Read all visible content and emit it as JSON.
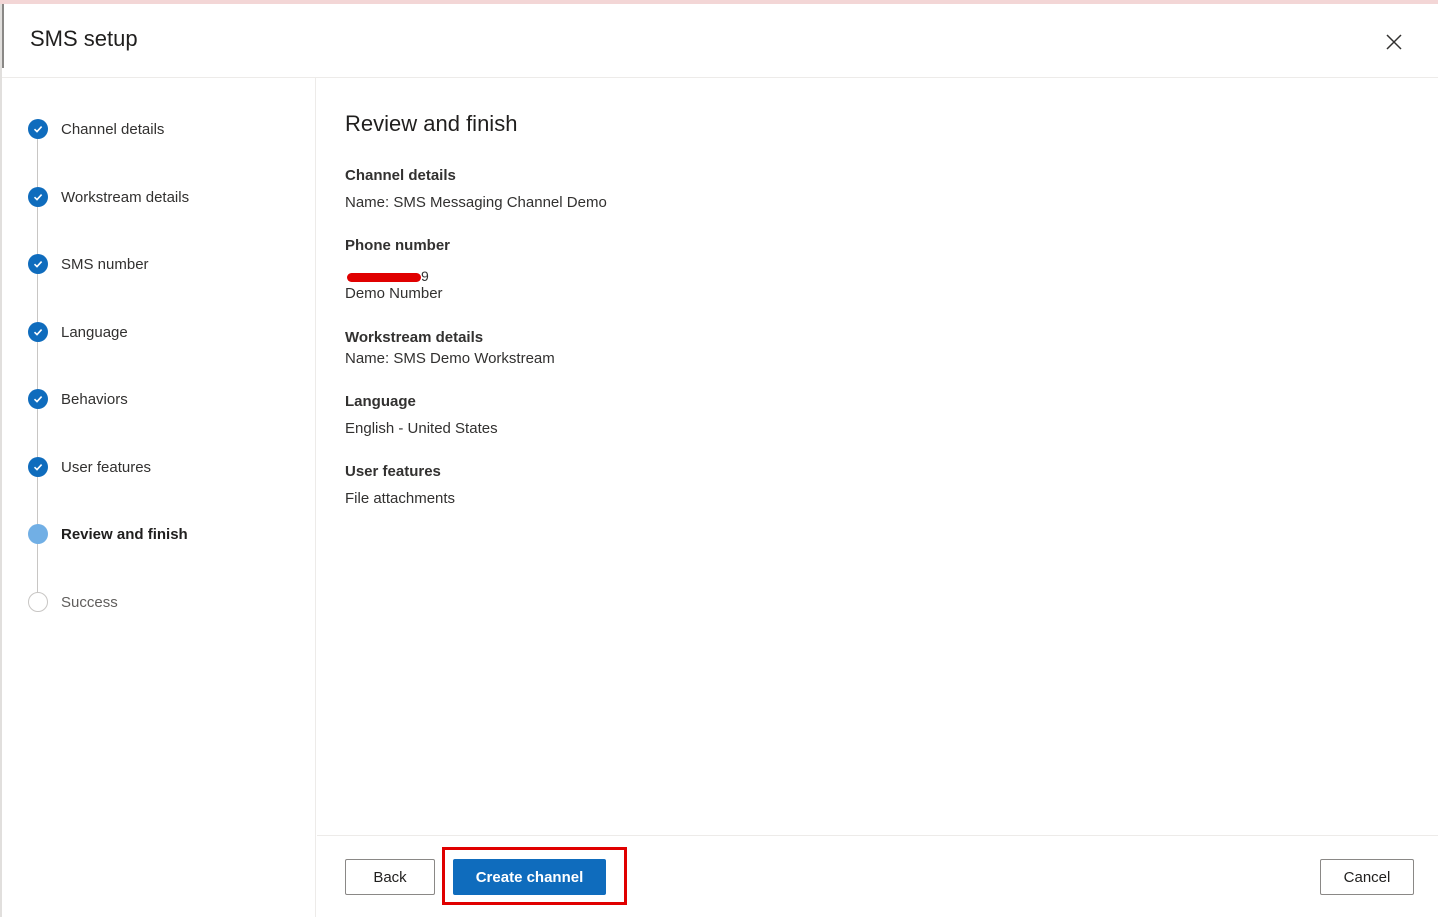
{
  "dialog": {
    "title": "SMS setup",
    "close_icon": "close-icon"
  },
  "steps": [
    {
      "label": "Channel details",
      "status": "completed"
    },
    {
      "label": "Workstream details",
      "status": "completed"
    },
    {
      "label": "SMS number",
      "status": "completed"
    },
    {
      "label": "Language",
      "status": "completed"
    },
    {
      "label": "Behaviors",
      "status": "completed"
    },
    {
      "label": "User features",
      "status": "completed"
    },
    {
      "label": "Review and finish",
      "status": "current"
    },
    {
      "label": "Success",
      "status": "pending"
    }
  ],
  "review": {
    "title": "Review and finish",
    "channel_details": {
      "heading": "Channel details",
      "value": "Name: SMS Messaging Channel Demo"
    },
    "phone_number": {
      "heading": "Phone number",
      "redacted_tail": "9",
      "value": "Demo Number"
    },
    "workstream_details": {
      "heading": "Workstream details",
      "value": "Name: SMS Demo Workstream"
    },
    "language": {
      "heading": "Language",
      "value": "English - United States"
    },
    "user_features": {
      "heading": "User features",
      "value": "File attachments"
    }
  },
  "footer": {
    "back_label": "Back",
    "create_label": "Create channel",
    "cancel_label": "Cancel"
  },
  "colors": {
    "accent": "#0f6cbd",
    "current_step": "#71afe5",
    "highlight": "#e00000"
  }
}
